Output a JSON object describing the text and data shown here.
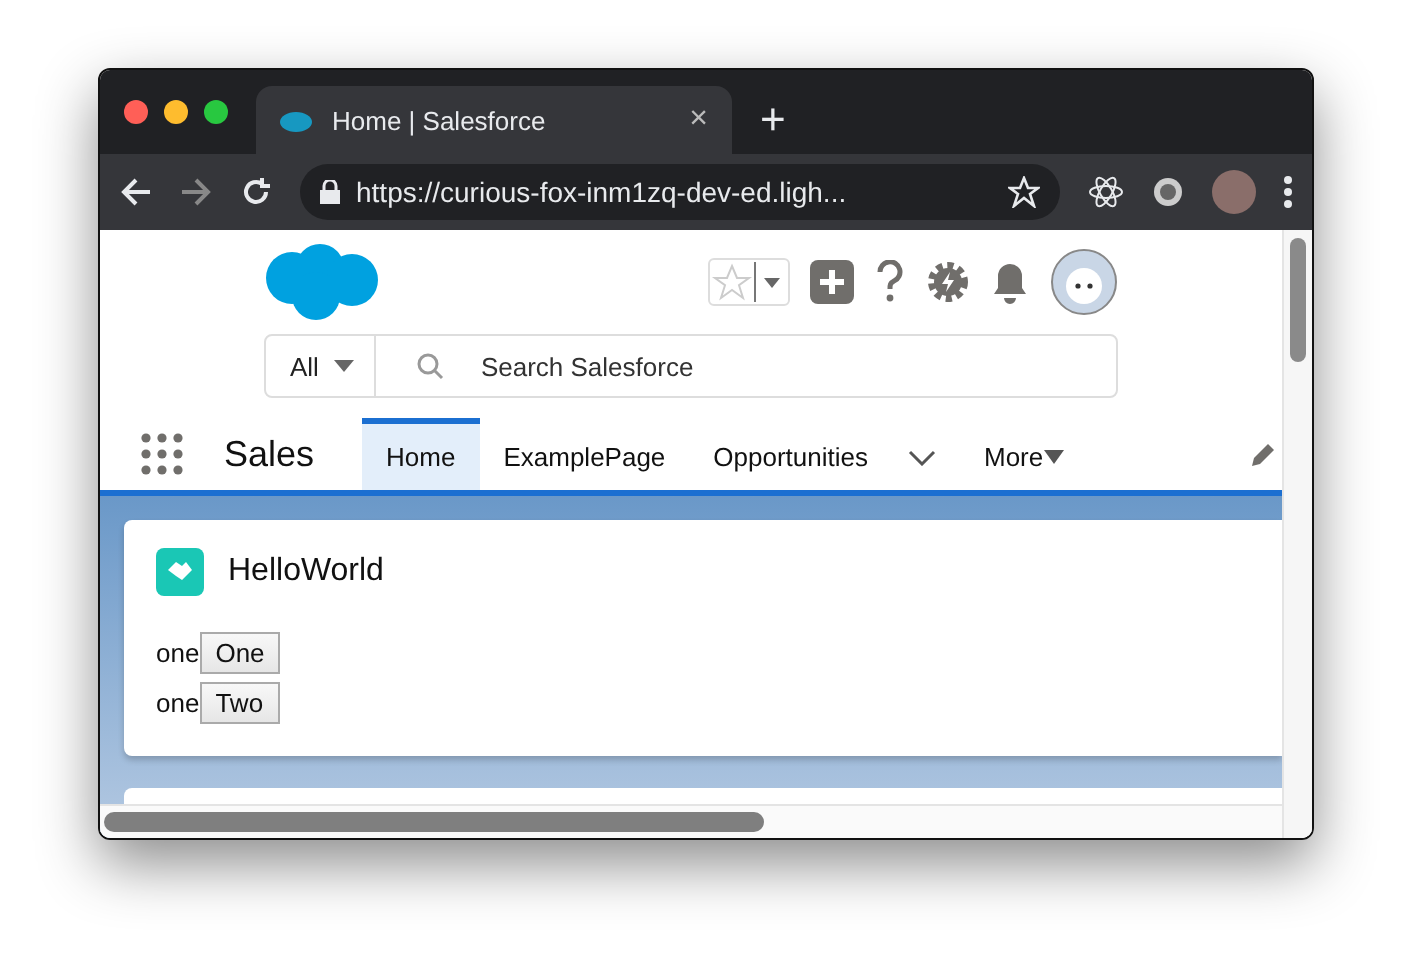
{
  "browser": {
    "tab_title": "Home | Salesforce",
    "tab_close": "×",
    "new_tab": "+",
    "url": "https://curious-fox-inm1zq-dev-ed.ligh..."
  },
  "header": {
    "search_scope": "All",
    "search_placeholder": "Search Salesforce"
  },
  "nav": {
    "app_name": "Sales",
    "tabs": [
      {
        "label": "Home",
        "selected": true,
        "kind": "plain"
      },
      {
        "label": "ExamplePage",
        "selected": false,
        "kind": "plain"
      },
      {
        "label": "Opportunities",
        "selected": false,
        "kind": "menu"
      },
      {
        "label": "More",
        "selected": false,
        "kind": "more"
      }
    ]
  },
  "card": {
    "title": "HelloWorld",
    "rows": [
      {
        "text": "one",
        "button": "One"
      },
      {
        "text": "one",
        "button": "Two"
      }
    ]
  }
}
